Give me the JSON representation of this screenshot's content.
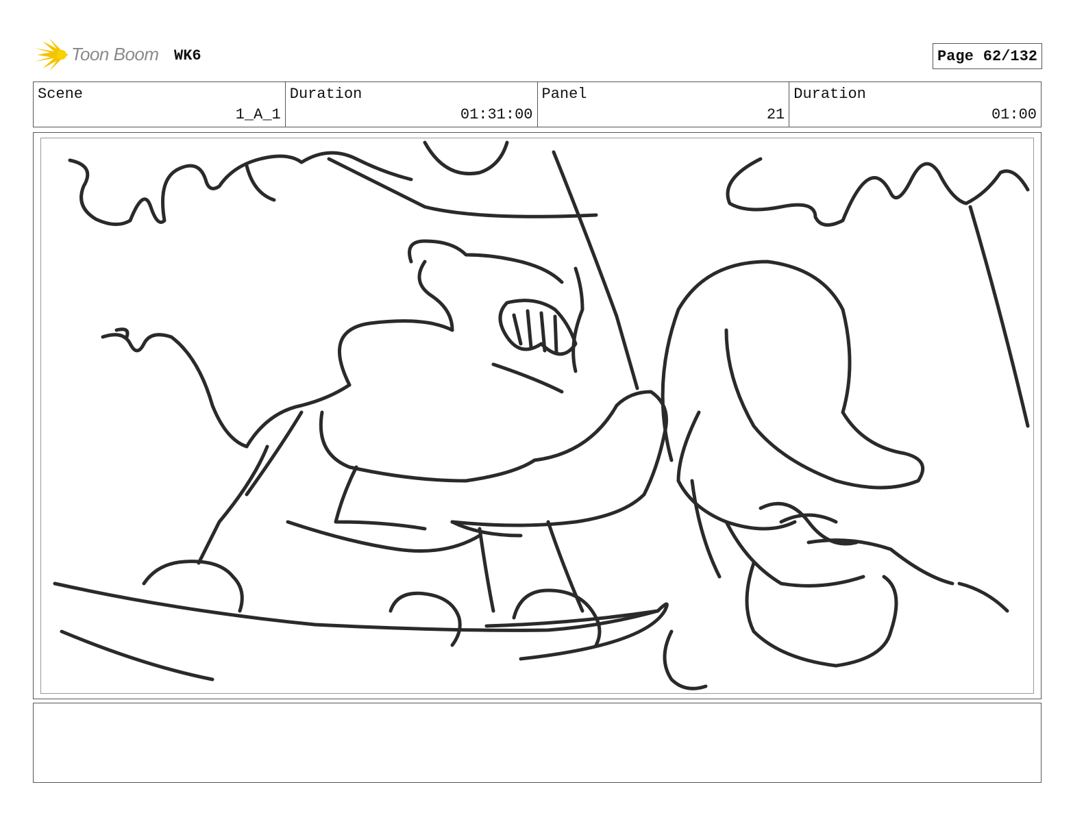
{
  "header": {
    "logo_text": "Toon Boom",
    "logo_icon": "starburst-logo-icon",
    "project": "WK6",
    "page_label": "Page",
    "page_number": "62/132"
  },
  "info": {
    "scene_label": "Scene",
    "scene_value": "1_A_1",
    "scene_duration_label": "Duration",
    "scene_duration_value": "01:31:00",
    "panel_label": "Panel",
    "panel_value": "21",
    "panel_duration_label": "Duration",
    "panel_duration_value": "01:00"
  },
  "panel_image": {
    "description_icon": "storyboard-sketch-image"
  },
  "notes": {
    "text": ""
  },
  "colors": {
    "logo_yellow": "#f5c400",
    "logo_text": "#8a8a8a",
    "border": "#555555",
    "sketch": "#2a2a2a"
  }
}
